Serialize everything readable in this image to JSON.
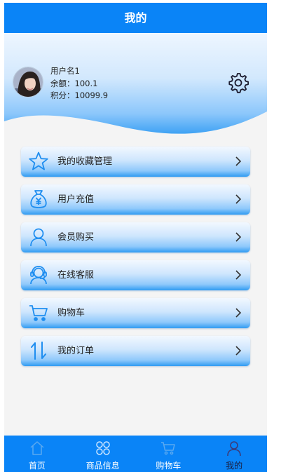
{
  "header": {
    "title": "我的"
  },
  "profile": {
    "username": "用户名1",
    "balance": "余额：100.1",
    "points": "积分：10099.9"
  },
  "menu": [
    {
      "label": "我的收藏管理",
      "icon": "star-icon"
    },
    {
      "label": "用户充值",
      "icon": "money-bag-icon"
    },
    {
      "label": "会员购买",
      "icon": "user-icon"
    },
    {
      "label": "在线客服",
      "icon": "customer-service-icon"
    },
    {
      "label": "购物车",
      "icon": "cart-icon"
    },
    {
      "label": "我的订单",
      "icon": "sort-arrows-icon"
    }
  ],
  "tabbar": [
    {
      "label": "首页",
      "icon": "home-icon"
    },
    {
      "label": "商品信息",
      "icon": "grid-icon"
    },
    {
      "label": "购物车",
      "icon": "cart-icon"
    },
    {
      "label": "我的",
      "icon": "user-icon",
      "active": true
    }
  ],
  "colors": {
    "primary": "#0a84f7",
    "icon_blue": "#1f8ef0",
    "dark_text": "#222222"
  }
}
